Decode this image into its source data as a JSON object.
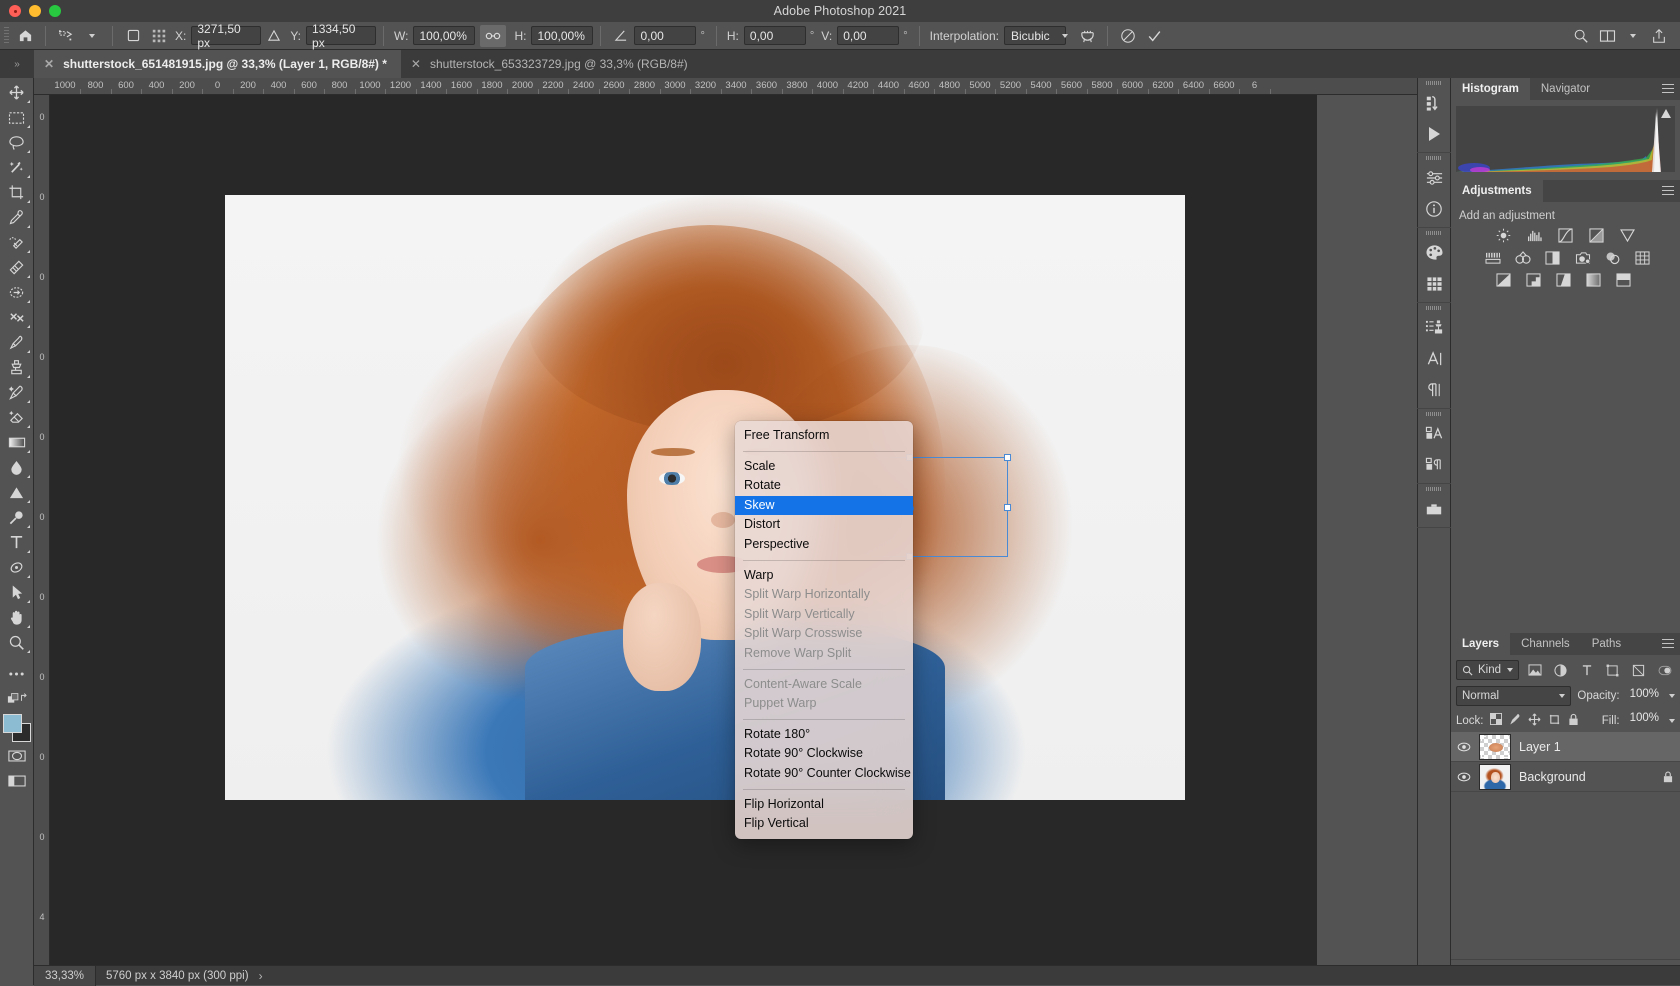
{
  "window": {
    "title": "Adobe Photoshop 2021"
  },
  "options_bar": {
    "home_icon": "home-icon",
    "tool_preset": "transform-tool-icon",
    "reference_point_label": "reference-point-toggle",
    "x_label": "X:",
    "x_value": "3271,50 px",
    "delta_icon": "delta-icon",
    "y_label": "Y:",
    "y_value": "1334,50 px",
    "w_label": "W:",
    "w_value": "100,00%",
    "link_icon": "link-icon",
    "h_label": "H:",
    "h_value": "100,00%",
    "angle_icon": "angle-icon",
    "angle_value": "0,00",
    "degree_symbol": "°",
    "skew_h_label": "H:",
    "skew_h_value": "0,00",
    "skew_v_label": "V:",
    "skew_v_value": "0,00",
    "interpolation_label": "Interpolation:",
    "interpolation_value": "Bicubic",
    "warp_icon": "warp-toggle-icon",
    "cancel_icon": "cancel-transform-icon",
    "commit_icon": "commit-transform-icon",
    "search_icon": "search-icon",
    "arrange_icon": "arrange-documents-icon",
    "share_icon": "share-icon"
  },
  "tabs": [
    {
      "label": "shutterstock_651481915.jpg @ 33,3% (Layer 1, RGB/8#) *",
      "active": true
    },
    {
      "label": "shutterstock_653323729.jpg @ 33,3% (RGB/8#)",
      "active": false
    }
  ],
  "toolbar": {
    "tools": [
      {
        "name": "move-tool",
        "icon": "move-icon"
      },
      {
        "name": "rectangular-marquee-tool",
        "icon": "marquee-icon"
      },
      {
        "name": "lasso-tool",
        "icon": "lasso-icon"
      },
      {
        "name": "object-selection-tool",
        "icon": "magic-wand-icon"
      },
      {
        "name": "crop-tool",
        "icon": "crop-icon"
      },
      {
        "name": "eyedropper-tool",
        "icon": "eyedropper-icon"
      },
      {
        "name": "spot-healing-brush-tool",
        "icon": "healing-brush-icon"
      },
      {
        "name": "patch-tool",
        "icon": "patch-icon"
      },
      {
        "name": "content-aware-move-tool",
        "icon": "content-move-icon"
      },
      {
        "name": "red-eye-tool",
        "icon": "red-eye-icon"
      },
      {
        "name": "brush-tool",
        "icon": "brush-icon"
      },
      {
        "name": "clone-stamp-tool",
        "icon": "clone-stamp-icon"
      },
      {
        "name": "history-brush-tool",
        "icon": "history-brush-icon"
      },
      {
        "name": "eraser-tool",
        "icon": "eraser-icon"
      },
      {
        "name": "gradient-tool",
        "icon": "gradient-icon"
      },
      {
        "name": "blur-tool",
        "icon": "blur-drop-icon"
      },
      {
        "name": "dodge-tool",
        "icon": "dodge-icon"
      },
      {
        "name": "pen-tool",
        "icon": "pen-icon"
      },
      {
        "name": "type-tool",
        "icon": "type-T-icon"
      },
      {
        "name": "path-selection-tool",
        "icon": "path-select-icon"
      },
      {
        "name": "direct-selection-tool",
        "icon": "arrow-pointer-icon"
      },
      {
        "name": "hand-tool",
        "icon": "hand-icon"
      },
      {
        "name": "zoom-tool",
        "icon": "magnifier-icon"
      },
      {
        "name": "edit-toolbar",
        "icon": "ellipsis-icon"
      },
      {
        "name": "default-colors",
        "icon": "default-colors-icon"
      }
    ],
    "foreground_color": "#8cbcd2",
    "background_color": "#2b2b2b",
    "quick_mask": "quick-mask-icon",
    "screen_mode": "screen-mode-icon"
  },
  "rulers": {
    "top_ticks": [
      "1000",
      "800",
      "600",
      "400",
      "200",
      "0",
      "200",
      "400",
      "600",
      "800",
      "1000",
      "1200",
      "1400",
      "1600",
      "1800",
      "2000",
      "2200",
      "2400",
      "2600",
      "2800",
      "3000",
      "3200",
      "3400",
      "3600",
      "3800",
      "4000",
      "4200",
      "4400",
      "4600",
      "4800",
      "5000",
      "5200",
      "5400",
      "5600",
      "5800",
      "6000",
      "6200",
      "6400",
      "6600",
      "6"
    ],
    "left_ticks": [
      "0",
      "0",
      "0",
      "0",
      "0",
      "0",
      "0",
      "0",
      "0",
      "0",
      "4"
    ]
  },
  "context_menu": {
    "items": [
      {
        "label": "Free Transform",
        "state": "normal"
      },
      {
        "type": "separator"
      },
      {
        "label": "Scale",
        "state": "normal"
      },
      {
        "label": "Rotate",
        "state": "normal"
      },
      {
        "label": "Skew",
        "state": "highlighted"
      },
      {
        "label": "Distort",
        "state": "normal"
      },
      {
        "label": "Perspective",
        "state": "normal"
      },
      {
        "type": "separator"
      },
      {
        "label": "Warp",
        "state": "normal"
      },
      {
        "label": "Split Warp Horizontally",
        "state": "disabled"
      },
      {
        "label": "Split Warp Vertically",
        "state": "disabled"
      },
      {
        "label": "Split Warp Crosswise",
        "state": "disabled"
      },
      {
        "label": "Remove Warp Split",
        "state": "disabled"
      },
      {
        "type": "separator"
      },
      {
        "label": "Content-Aware Scale",
        "state": "disabled"
      },
      {
        "label": "Puppet Warp",
        "state": "disabled"
      },
      {
        "type": "separator"
      },
      {
        "label": "Rotate 180°",
        "state": "normal"
      },
      {
        "label": "Rotate 90° Clockwise",
        "state": "normal"
      },
      {
        "label": "Rotate 90° Counter Clockwise",
        "state": "normal"
      },
      {
        "type": "separator"
      },
      {
        "label": "Flip Horizontal",
        "state": "normal"
      },
      {
        "label": "Flip Vertical",
        "state": "normal"
      }
    ],
    "highlight_color": "#1473e6"
  },
  "rail": {
    "buttons": [
      {
        "name": "history-panel-icon"
      },
      {
        "name": "actions-play-icon"
      },
      {
        "name": "properties-panel-icon"
      },
      {
        "name": "info-panel-icon"
      },
      {
        "name": "color-swatches-icon"
      },
      {
        "name": "pattern-grid-icon"
      },
      {
        "name": "clone-source-icon"
      },
      {
        "name": "character-panel-icon"
      },
      {
        "name": "paragraph-panel-icon"
      },
      {
        "name": "character-styles-icon"
      },
      {
        "name": "paragraph-styles-icon"
      },
      {
        "name": "libraries-icon"
      }
    ]
  },
  "histogram_panel": {
    "tabs": [
      {
        "label": "Histogram",
        "active": true
      },
      {
        "label": "Navigator",
        "active": false
      }
    ],
    "menu_icon": "panel-menu-icon",
    "uncached_warning_icon": "uncached-refresh-icon"
  },
  "adjustments_panel": {
    "tabs": [
      {
        "label": "Adjustments",
        "active": true
      }
    ],
    "hint": "Add an adjustment",
    "menu_icon": "panel-menu-icon",
    "row1": [
      "brightness-contrast-icon",
      "levels-icon",
      "curves-icon",
      "exposure-icon",
      "vibrance-icon"
    ],
    "row2": [
      "hue-saturation-icon",
      "color-balance-icon",
      "black-white-icon",
      "photo-filter-icon",
      "channel-mixer-icon",
      "color-lookup-icon"
    ],
    "row3": [
      "invert-icon",
      "posterize-icon",
      "threshold-icon",
      "gradient-map-icon",
      "selective-color-icon"
    ]
  },
  "layers_panel": {
    "tabs": [
      {
        "label": "Layers",
        "active": true
      },
      {
        "label": "Channels",
        "active": false
      },
      {
        "label": "Paths",
        "active": false
      }
    ],
    "menu_icon": "panel-menu-icon",
    "filter": {
      "kind_label": "Kind",
      "search_icon": "search-icon",
      "filter_icons": [
        "filter-pixel-icon",
        "filter-adjustment-icon",
        "filter-type-icon",
        "filter-shape-icon",
        "filter-smart-icon"
      ],
      "toggle_icon": "filter-power-toggle"
    },
    "blend_mode": "Normal",
    "opacity_label": "Opacity:",
    "opacity_value": "100%",
    "lock_label": "Lock:",
    "lock_icons": [
      "lock-transparent-pixels-icon",
      "lock-image-pixels-icon",
      "lock-position-icon",
      "lock-artboard-nesting-icon",
      "lock-all-icon"
    ],
    "fill_label": "Fill:",
    "fill_value": "100%",
    "layers": [
      {
        "name": "Layer 1",
        "visible": true,
        "selected": true,
        "locked": false,
        "thumb": "transparent-face-thumb"
      },
      {
        "name": "Background",
        "visible": true,
        "selected": false,
        "locked": true,
        "thumb": "photo-thumb"
      }
    ],
    "bottom_buttons": [
      "link-layers-icon",
      "layer-styles-fx-icon",
      "add-layer-mask-icon",
      "new-fill-adjustment-icon",
      "new-group-icon",
      "new-layer-icon",
      "delete-layer-icon"
    ]
  },
  "status_bar": {
    "zoom": "33,33%",
    "doc_size": "5760 px x 3840 px (300 ppi)",
    "expand_icon": "chevron-right-icon"
  },
  "colors": {
    "app_bg": "#535353",
    "titlebar": "#3e3e3e",
    "canvas_bg": "#282828",
    "panel_tab_bg": "#454545",
    "accent_blue": "#1473e6",
    "transform_outline": "#4a8ad4"
  }
}
